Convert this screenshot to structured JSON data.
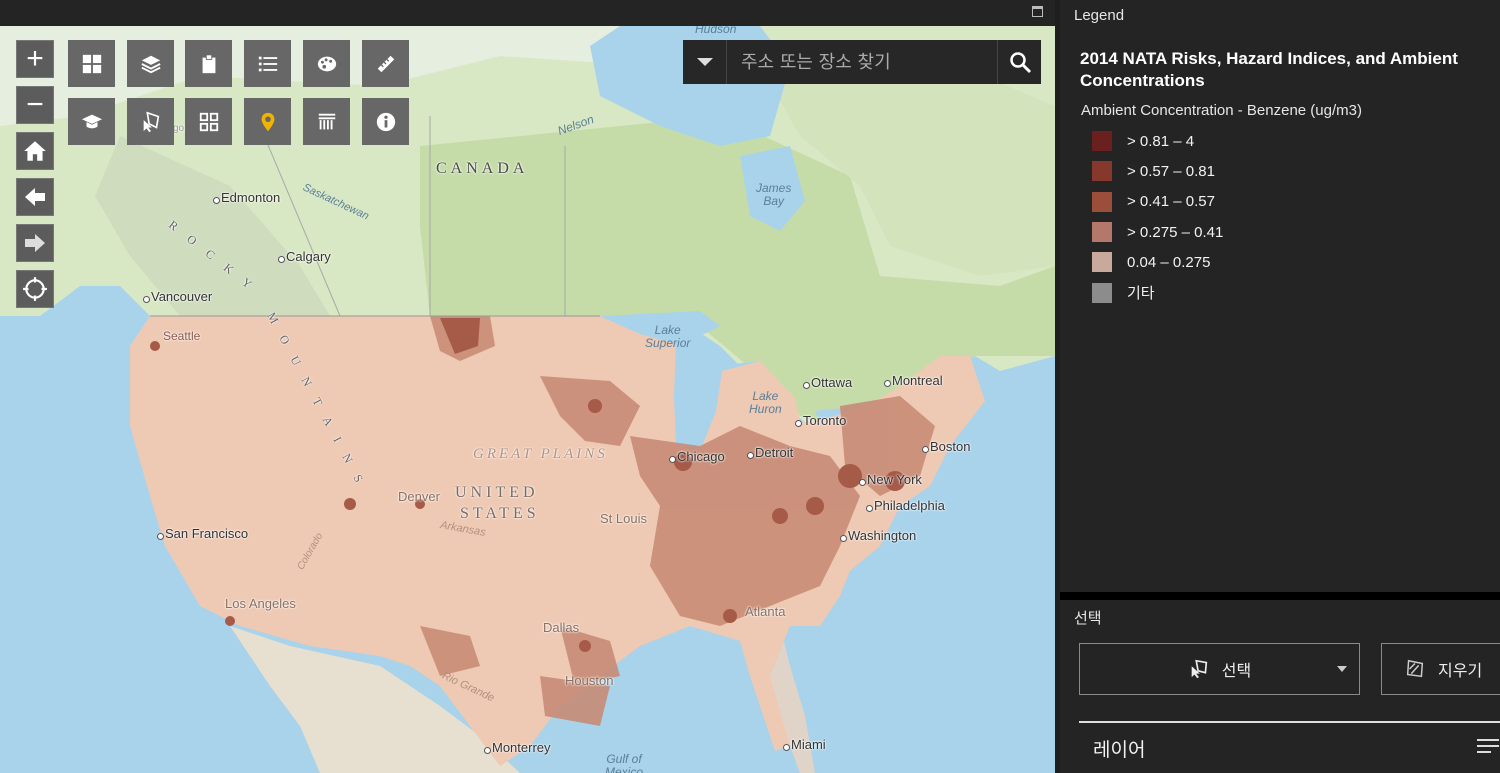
{
  "map": {
    "search": {
      "placeholder": "주소 또는 장소 찾기"
    },
    "zoom": {
      "in": "+",
      "out": "−"
    },
    "labels": {
      "hudson": "Hudson",
      "canada": "CANADA",
      "nelson": "Nelson",
      "edmonton": "Edmonton",
      "saskatchewan": "Saskatchewan",
      "james_bay": "James\nBay",
      "rocky": "R O C K Y",
      "mountains": "M O U N T A I N S",
      "calgary": "Calgary",
      "vancouver": "Vancouver",
      "seattle": "Seattle",
      "lake_superior": "Lake\nSuperior",
      "ottawa": "Ottawa",
      "montreal": "Montreal",
      "lake_huron": "Lake\nHuron",
      "toronto": "Toronto",
      "boston": "Boston",
      "great_plains": "GREAT PLAINS",
      "chicago": "Chicago",
      "detroit": "Detroit",
      "new_york": "New York",
      "united": "UNITED",
      "states": "STATES",
      "denver": "Denver",
      "philadelphia": "Philadelphia",
      "st_louis": "St Louis",
      "san_francisco": "San Francisco",
      "arkansas": "Arkansas",
      "colorado": "Colorado",
      "washington": "Washington",
      "los_angeles": "Los Angeles",
      "atlanta": "Atlanta",
      "dallas": "Dallas",
      "houston": "Houston",
      "rio_grande": "Rio Grande",
      "monterrey": "Monterrey",
      "miami": "Miami",
      "gulf_of_mexico": "Gulf of\nMexico",
      "fargo": "Fargo"
    }
  },
  "legend": {
    "title": "Legend",
    "layer_title": "2014 NATA Risks, Hazard Indices, and Ambient Concentrations",
    "field": "Ambient Concentration - Benzene (ug/m3)",
    "items": [
      {
        "label": "> 0.81 – 4",
        "color": "#6b2020"
      },
      {
        "label": "> 0.57 – 0.81",
        "color": "#85382b"
      },
      {
        "label": "> 0.41 – 0.57",
        "color": "#9b4f3a"
      },
      {
        "label": "> 0.275 – 0.41",
        "color": "#b3786a"
      },
      {
        "label": "0.04 – 0.275",
        "color": "#c8a99b"
      },
      {
        "label": "기타",
        "color": "#8c8c8c"
      }
    ]
  },
  "select": {
    "title": "선택",
    "select_label": "선택",
    "clear_label": "지우기",
    "layer_title": "레이어"
  }
}
